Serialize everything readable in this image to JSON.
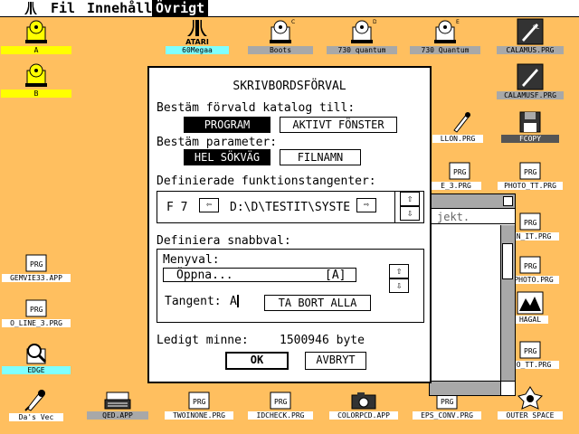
{
  "menubar": {
    "logo": "atari-logo-icon",
    "items": [
      "Fil",
      "Innehåll",
      "Övrigt"
    ],
    "active_index": 2
  },
  "desktop": {
    "icons": [
      {
        "name": "drive-a-icon",
        "label": "A",
        "style": "yellow"
      },
      {
        "name": "drive-b-icon",
        "label": "B",
        "style": "yellow"
      },
      {
        "name": "atari-icon",
        "label": "60Megaa",
        "style": "cyan"
      },
      {
        "name": "drive-c-icon",
        "label": "Boots",
        "style": "gray"
      },
      {
        "name": "drive-d-icon",
        "label": "730 quantum",
        "style": "gray"
      },
      {
        "name": "drive-e-icon",
        "label": "730 Quantum",
        "style": "gray"
      },
      {
        "name": "calamus-icon",
        "label": "CALAMUS.PRG",
        "style": "gray"
      },
      {
        "name": "calamusf-icon",
        "label": "CALAMUSF.PRG",
        "style": "gray"
      },
      {
        "name": "fcopy-icon",
        "label": "FCOPY",
        "style": "dark"
      },
      {
        "name": "program-icon",
        "label": "LLON.PRG",
        "style": "white"
      },
      {
        "name": "program-icon",
        "label": "E_3.PRG",
        "style": "white"
      },
      {
        "name": "program-icon",
        "label": "PHOTO_TT.PRG",
        "style": "white"
      },
      {
        "name": "program-icon",
        "label": "N_IT.PRG",
        "style": "white"
      },
      {
        "name": "program-icon",
        "label": "PHOTO.PRG",
        "style": "white"
      },
      {
        "name": "hagal-icon",
        "label": "HAGAL",
        "style": "white"
      },
      {
        "name": "program-icon",
        "label": "O_TT.PRG",
        "style": "white"
      },
      {
        "name": "program-icon",
        "label": "GEMVIE33.APP",
        "style": "white"
      },
      {
        "name": "program-icon",
        "label": "O_LINE_3.PRG",
        "style": "white"
      },
      {
        "name": "edge-icon",
        "label": "EDGE",
        "style": "cyan"
      },
      {
        "name": "quill-icon",
        "label": "Da's Vec",
        "style": "white"
      },
      {
        "name": "typewriter-icon",
        "label": "QED.APP",
        "style": "gray"
      },
      {
        "name": "program-icon",
        "label": "TWOINONE.PRG",
        "style": "white"
      },
      {
        "name": "program-icon",
        "label": "IDCHECK.PRG",
        "style": "white"
      },
      {
        "name": "camera-icon",
        "label": "COLORPCD.APP",
        "style": "white"
      },
      {
        "name": "program-icon",
        "label": "EPS_CONV.PRG",
        "style": "white"
      },
      {
        "name": "program-icon",
        "label": "PHOTO_TT.PRG",
        "style": "white"
      },
      {
        "name": "outer-space-icon",
        "label": "OUTER SPACE",
        "style": "white"
      }
    ]
  },
  "background_window": {
    "info_text": "jekt."
  },
  "dialog": {
    "title": "SKRIVBORDSFÖRVAL",
    "catalog_heading": "Bestäm förvald katalog till:",
    "catalog_options": [
      "PROGRAM",
      "AKTIVT FÖNSTER"
    ],
    "catalog_selected": 0,
    "param_heading": "Bestäm parameter:",
    "param_options": [
      "HEL SÖKVÄG",
      "FILNAMN"
    ],
    "param_selected": 0,
    "fkey_heading": "Definierade funktionstangenter:",
    "fkey_label": "F 7",
    "fkey_path": "D:\\D\\TESTIT\\SYSTE",
    "shortcut_heading": "Definiera snabbval:",
    "menu_choice_label": "Menyval:",
    "menu_choice_value": "Öppna...",
    "menu_choice_key": "[A]",
    "key_label": "Tangent:",
    "key_value": "A",
    "clear_all_button": "TA BORT ALLA",
    "free_memory_label": "Ledigt minne:",
    "free_memory_value": "1500946 byte",
    "ok_button": "OK",
    "cancel_button": "AVBRYT"
  }
}
